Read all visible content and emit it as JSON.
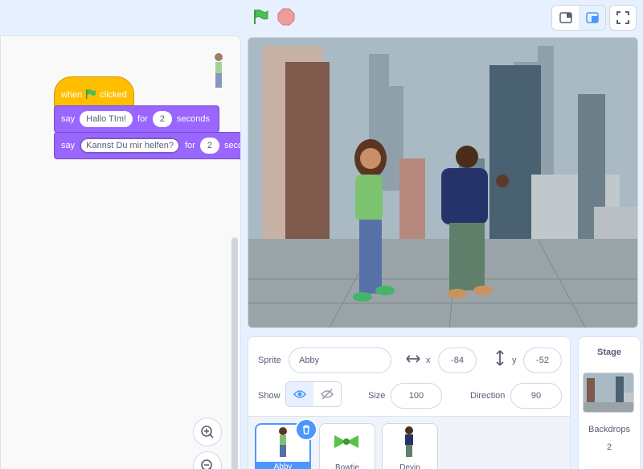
{
  "colors": {
    "accent": "#4c97ff",
    "events": "#ffbf00",
    "looks": "#9966ff",
    "background": "#e6f0ff"
  },
  "code": {
    "hat": {
      "when": "when",
      "clicked": "clicked"
    },
    "say1": {
      "say": "say",
      "text": "Hallo TIm!",
      "for": "for",
      "secs": "2",
      "seconds": "seconds"
    },
    "say2": {
      "say": "say",
      "text": "Kannst Du mir helfen?",
      "for": "for",
      "secs": "2",
      "seconds": "seco"
    }
  },
  "sprite_info": {
    "sprite_label": "Sprite",
    "sprite_name": "Abby",
    "x_label": "x",
    "x_value": "-84",
    "y_label": "y",
    "y_value": "-52",
    "show_label": "Show",
    "size_label": "Size",
    "size_value": "100",
    "direction_label": "Direction",
    "direction_value": "90"
  },
  "sprites": [
    {
      "name": "Abby",
      "selected": true
    },
    {
      "name": "Bowtie",
      "selected": false
    },
    {
      "name": "Devin",
      "selected": false
    }
  ],
  "stage_panel": {
    "title": "Stage",
    "backdrops_label": "Backdrops",
    "backdrops_count": "2"
  },
  "icons": [
    "green-flag-icon",
    "stop-icon",
    "small-stage-icon",
    "normal-stage-icon",
    "fullscreen-icon",
    "zoom-in-icon",
    "zoom-out-icon",
    "eye-icon",
    "eye-slash-icon",
    "trash-icon",
    "arrows-horizontal-icon",
    "arrows-vertical-icon"
  ]
}
